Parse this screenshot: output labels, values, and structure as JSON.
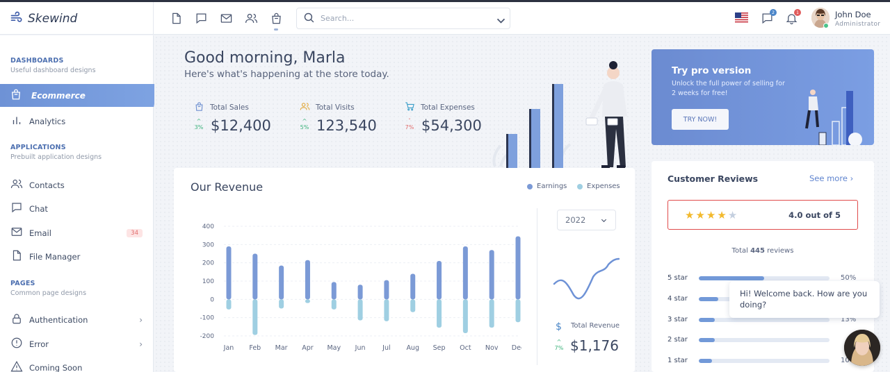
{
  "brand": {
    "name": "Skewind"
  },
  "header": {
    "search_placeholder": "Search...",
    "messages_badge": "2",
    "notifications_badge": "1",
    "user_name": "John Doe",
    "user_role": "Administrator"
  },
  "sidebar": {
    "dashboards_title": "DASHBOARDS",
    "dashboards_sub": "Useful dashboard designs",
    "ecommerce": "Ecommerce",
    "analytics": "Analytics",
    "applications_title": "APPLICATIONS",
    "applications_sub": "Prebuilt application designs",
    "contacts": "Contacts",
    "chat": "Chat",
    "email": "Email",
    "email_count": "34",
    "file_manager": "File Manager",
    "pages_title": "PAGES",
    "pages_sub": "Common page designs",
    "authentication": "Authentication",
    "error": "Error",
    "coming_soon": "Coming Soon"
  },
  "welcome": {
    "title": "Good morning, Marla",
    "subtitle": "Here's what's happening at the store today."
  },
  "stats": [
    {
      "label": "Total Sales",
      "value": "$12,400",
      "change": "3%",
      "direction": "up"
    },
    {
      "label": "Total Visits",
      "value": "123,540",
      "change": "5%",
      "direction": "up"
    },
    {
      "label": "Total Expenses",
      "value": "$54,300",
      "change": "7%",
      "direction": "down"
    }
  ],
  "promo": {
    "title": "Try pro version",
    "text": "Unlock the full power of selling for 2 weeks for free!",
    "button": "TRY NOW!"
  },
  "revenue": {
    "title": "Our Revenue",
    "legend_earnings": "Earnings",
    "legend_expenses": "Expenses",
    "year": "2022",
    "total_label": "Total Revenue",
    "total_value": "$1,176",
    "total_change": "7%"
  },
  "reviews": {
    "title": "Customer Reviews",
    "see_more": "See more",
    "rating_text": "4.0 out of 5",
    "stars": 4,
    "total_prefix": "Total ",
    "total_count": "445",
    "total_suffix": " reviews",
    "rows": [
      {
        "label": "5 star",
        "percent": 50,
        "pct_text": "50%"
      },
      {
        "label": "4 star",
        "percent": 15,
        "pct_text": ""
      },
      {
        "label": "3 star",
        "percent": 12,
        "pct_text": "13%"
      },
      {
        "label": "2 star",
        "percent": 12,
        "pct_text": ""
      },
      {
        "label": "1 star",
        "percent": 10,
        "pct_text": "10"
      }
    ]
  },
  "chat": {
    "message": "Hi! Welcome back. How are you doing?"
  },
  "colors": {
    "accent": "#6e92d6",
    "earnings": "#7b9ad6",
    "expenses": "#9fcfe2",
    "up": "#39b179",
    "down": "#e06a6a"
  },
  "chart_data": {
    "type": "bar",
    "categories": [
      "Jan",
      "Feb",
      "Mar",
      "Apr",
      "May",
      "Jun",
      "Jul",
      "Aug",
      "Sep",
      "Oct",
      "Nov",
      "Dec"
    ],
    "series": [
      {
        "name": "Earnings",
        "values": [
          290,
          250,
          185,
          215,
          95,
          80,
          105,
          140,
          210,
          290,
          270,
          345
        ]
      },
      {
        "name": "Expenses",
        "values": [
          -55,
          -195,
          -50,
          -20,
          -55,
          -115,
          -120,
          -70,
          -155,
          -185,
          -155,
          -125
        ]
      }
    ],
    "yticks": [
      400,
      300,
      200,
      100,
      0,
      -100,
      -200
    ],
    "ylim": [
      -200,
      400
    ],
    "grid": true
  }
}
